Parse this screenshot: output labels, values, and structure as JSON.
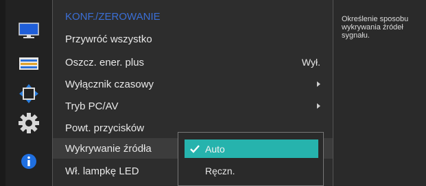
{
  "menu": {
    "title": "KONF./ZEROWANIE",
    "items": [
      {
        "label": "Przywróć wszystko",
        "value": "",
        "arrow": false
      },
      {
        "label": "Oszcz. ener. plus",
        "value": "Wył.",
        "arrow": false
      },
      {
        "label": "Wyłącznik czasowy",
        "value": "",
        "arrow": true
      },
      {
        "label": "Tryb PC/AV",
        "value": "",
        "arrow": true
      },
      {
        "label": "Powt. przycisków",
        "value": "",
        "arrow": false
      },
      {
        "label": "Wykrywanie źródła",
        "value": "",
        "arrow": false
      },
      {
        "label": "Wł. lampkę LED",
        "value": "",
        "arrow": false
      }
    ]
  },
  "popup": {
    "options": [
      {
        "label": "Auto",
        "selected": true
      },
      {
        "label": "Ręczn.",
        "selected": false
      }
    ]
  },
  "help": {
    "text": "Określenie sposobu wykrywania źródeł sygnału."
  },
  "sidebar": {
    "icons": [
      "picture-icon",
      "osd-icon",
      "size-position-icon",
      "setup-gear-icon",
      "info-icon"
    ]
  },
  "colors": {
    "accent_blue": "#3b6fd6",
    "highlight_teal": "#26b3ad",
    "panel_bg": "#2d2d2d"
  }
}
